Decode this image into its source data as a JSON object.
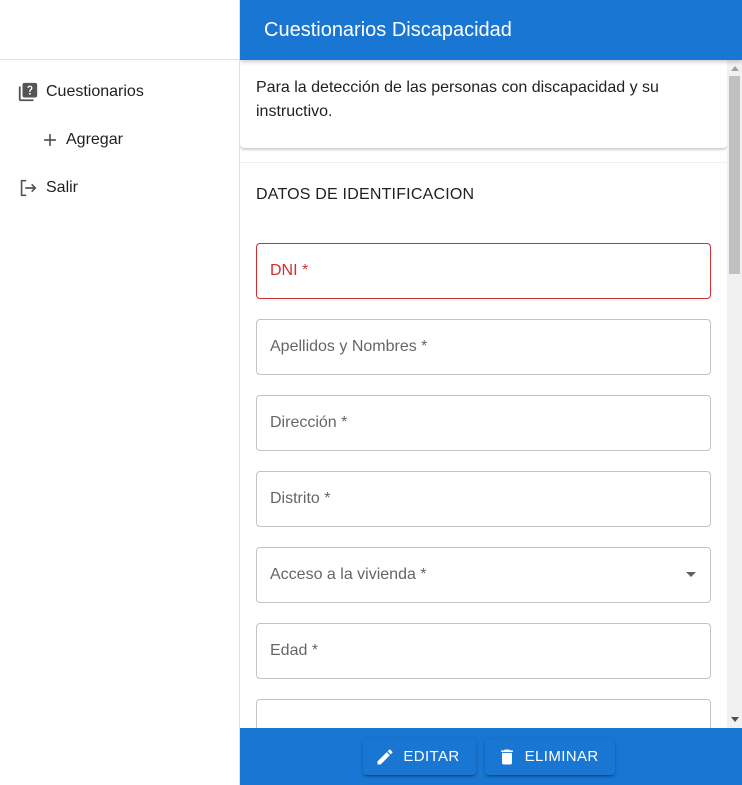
{
  "sidebar": {
    "items": [
      {
        "label": "Cuestionarios",
        "icon": "quiz-icon"
      },
      {
        "label": "Agregar",
        "icon": "plus-icon"
      },
      {
        "label": "Salir",
        "icon": "logout-icon"
      }
    ]
  },
  "header": {
    "title": "Cuestionarios Discapacidad"
  },
  "description": "Para la detección de las personas con discapacidad y su instructivo.",
  "section": {
    "title": "DATOS DE IDENTIFICACION"
  },
  "fields": [
    {
      "label": "DNI *",
      "state": "error"
    },
    {
      "label": "Apellidos y Nombres *"
    },
    {
      "label": "Dirección *"
    },
    {
      "label": "Distrito *"
    },
    {
      "label": "Acceso a la vivienda *",
      "type": "select"
    },
    {
      "label": "Edad *"
    },
    {
      "label": ""
    }
  ],
  "footer": {
    "edit_label": "EDITAR",
    "delete_label": "ELIMINAR"
  },
  "colors": {
    "primary": "#1976d2",
    "error": "#d32f2f"
  }
}
